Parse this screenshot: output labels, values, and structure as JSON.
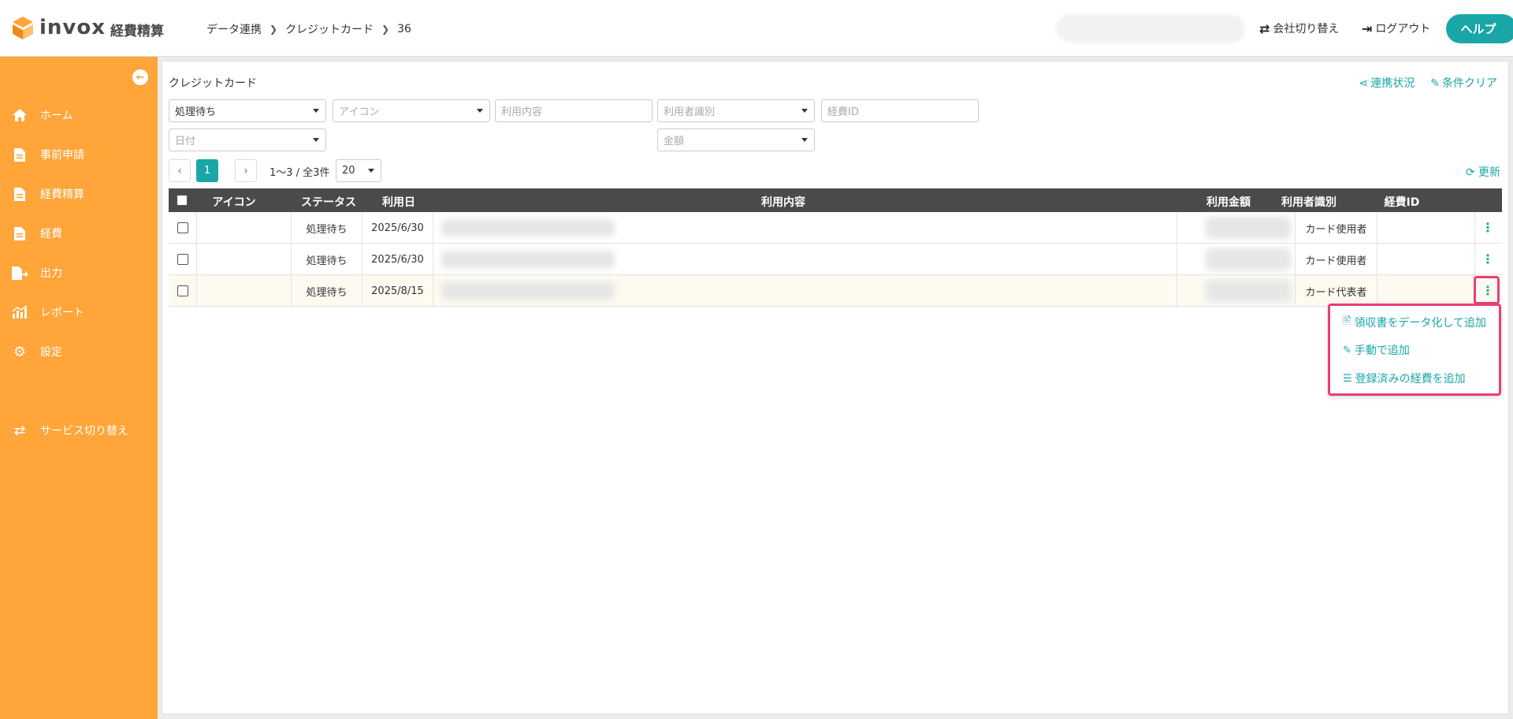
{
  "header": {
    "logo_text": "invox",
    "logo_sub": "経費精算",
    "breadcrumb": [
      "データ連携",
      "クレジットカード",
      "36"
    ],
    "switch_company": "会社切り替え",
    "logout": "ログアウト",
    "help": "ヘルプ"
  },
  "sidebar": {
    "items": [
      {
        "label": "ホーム",
        "icon": "home-icon"
      },
      {
        "label": "事前申請",
        "icon": "document-icon"
      },
      {
        "label": "経費精算",
        "icon": "document-icon"
      },
      {
        "label": "経費",
        "icon": "document-icon"
      },
      {
        "label": "出力",
        "icon": "export-icon"
      },
      {
        "label": "レポート",
        "icon": "chart-icon"
      },
      {
        "label": "設定",
        "icon": "gear-icon"
      },
      {
        "label": "サービス切り替え",
        "icon": "switch-icon"
      }
    ]
  },
  "main": {
    "title": "クレジットカード",
    "link_status": "連携状況",
    "link_clear": "条件クリア",
    "filters": {
      "status": "処理待ち",
      "icon_ph": "アイコン",
      "content_ph": "利用内容",
      "user_ph": "利用者識別",
      "expense_id_ph": "経費ID",
      "date_ph": "日付",
      "amount_ph": "金額"
    },
    "pager": {
      "current": "1",
      "info": "1〜3 / 全3件",
      "per_page": "20"
    },
    "refresh": "更新",
    "table": {
      "headers": [
        "アイコン",
        "ステータス",
        "利用日",
        "利用内容",
        "利用金額",
        "利用者識別",
        "経費ID"
      ],
      "rows": [
        {
          "status": "処理待ち",
          "date": "2025/6/30",
          "user": "カード使用者"
        },
        {
          "status": "処理待ち",
          "date": "2025/6/30",
          "user": "カード使用者"
        },
        {
          "status": "処理待ち",
          "date": "2025/8/15",
          "user": "カード代表者"
        }
      ]
    },
    "row_menu": [
      "領収書をデータ化して追加",
      "手動で追加",
      "登録済みの経費を追加"
    ]
  },
  "colors": {
    "accent": "#1aa6a6",
    "sidebar": "#ffa53a",
    "highlight": "#e83e7a"
  }
}
